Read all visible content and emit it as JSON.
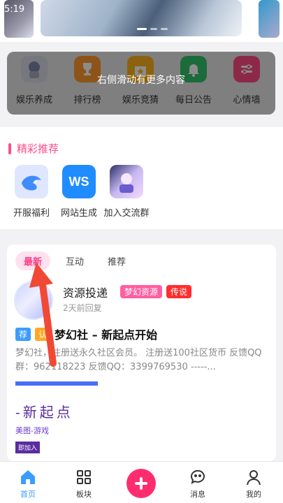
{
  "status_time": "5:19",
  "quick_grid": {
    "items": [
      {
        "label": "娱乐养成",
        "icon": "anime-girl-icon",
        "color": "#d9dbe8"
      },
      {
        "label": "排行榜",
        "icon": "trophy-icon",
        "color": "#ff9a2e"
      },
      {
        "label": "娱乐竞猜",
        "icon": "castle-star-icon",
        "color": "#ffb21c"
      },
      {
        "label": "每日公告",
        "icon": "bell-icon",
        "color": "#33c36b"
      },
      {
        "label": "心情墙",
        "icon": "sliders-icon",
        "color": "#ff4b86"
      }
    ],
    "hint": "右侧滑动有更多内容"
  },
  "recommend": {
    "title": "精彩推荐",
    "tiles": [
      {
        "label": "开服福利",
        "icon": "whale-app-icon"
      },
      {
        "label": "网站生成",
        "icon": "ws-app-icon",
        "text": "WS"
      },
      {
        "label": "加入交流群",
        "icon": "anime-group-icon"
      }
    ]
  },
  "feed": {
    "tabs": [
      "最新",
      "互动",
      "推荐"
    ],
    "post": {
      "author": "资源投递",
      "badges": [
        {
          "text": "梦幻资源",
          "color": "#ff5fa0"
        },
        {
          "text": "传说",
          "color": "#ff2d2d"
        }
      ],
      "time": "2天前回复",
      "tags": [
        {
          "text": "荐",
          "color": "#3b9cff"
        },
        {
          "text": "认",
          "color": "#ffa726"
        }
      ],
      "title": "梦幻社 – 新起点开始",
      "excerpt_line1": "梦幻社，注册送永久社区会员。 注册送100社区货币 反馈QQ",
      "excerpt_line2": "群：962118223 反馈QQ：3399769530 -----...",
      "thumb": {
        "big_text": "-新起点",
        "sub_text": "美图-游戏",
        "button": "即加入"
      }
    }
  },
  "nav": {
    "items": [
      {
        "label": "首页",
        "icon": "home-icon"
      },
      {
        "label": "板块",
        "icon": "grid-icon"
      },
      {
        "label": "",
        "icon": "plus-icon"
      },
      {
        "label": "消息",
        "icon": "message-icon"
      },
      {
        "label": "我的",
        "icon": "person-icon"
      }
    ]
  },
  "colors": {
    "accent_pink": "#ff4b8b",
    "nav_active": "#3b9cff",
    "plus_button": "#ff2d6f",
    "arrow": "#f04a36"
  }
}
